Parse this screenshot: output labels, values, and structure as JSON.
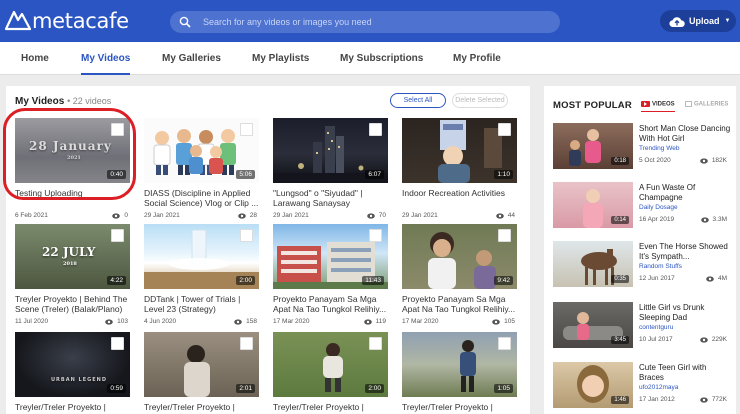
{
  "header": {
    "logo_text": "metacafe",
    "search_placeholder": "Search for any videos or images you need",
    "upload_label": "Upload"
  },
  "nav": {
    "items": [
      "Home",
      "My Videos",
      "My Galleries",
      "My Playlists",
      "My Subscriptions",
      "My Profile"
    ],
    "active": "My Videos"
  },
  "main": {
    "title": "My Videos",
    "count": "• 22 videos",
    "select_all": "Select All",
    "delete_selected": "Delete Selected",
    "videos": [
      {
        "title": "Testing Uploading",
        "date": "6 Feb 2021",
        "views": "0",
        "duration": "0:40",
        "thumb_text": "28 January",
        "thumb_year": "2021"
      },
      {
        "title": "DIASS (Discipline in Applied Social Science) Vlog or Clip ...",
        "date": "29 Jan 2021",
        "views": "28",
        "duration": "5:06"
      },
      {
        "title": "\"Lungsod\" o \"Siyudad\" | Larawang Sanaysay",
        "date": "29 Jan 2021",
        "views": "70",
        "duration": "6:07"
      },
      {
        "title": "Indoor Recreation Activities",
        "date": "29 Jan 2021",
        "views": "44",
        "duration": "1:10"
      },
      {
        "title": "Treyler Proyekto | Behind The Scene (Treler) (Balak/Plano) ...",
        "date": "11 Jul 2020",
        "views": "103",
        "duration": "4:22",
        "thumb_text": "22 JULY",
        "thumb_year": "2018"
      },
      {
        "title": "DDTank | Tower of Trials | Level 23 (Strategy)",
        "date": "4 Jun 2020",
        "views": "158",
        "duration": "2:00"
      },
      {
        "title": "Proyekto Panayam Sa Mga Apat Na Tao Tungkol Relihiy...",
        "date": "17 Mar 2020",
        "views": "119",
        "duration": "11:43"
      },
      {
        "title": "Proyekto Panayam Sa Mga Apat Na Tao Tungkol Relihiy...",
        "date": "17 Mar 2020",
        "views": "105",
        "duration": "9:42"
      },
      {
        "title": "Treyler/Treler Proyekto | Hango Buod (Project N...",
        "date": "",
        "views": "",
        "duration": "0:59",
        "thumb_text": "URBAN LEGEND"
      },
      {
        "title": "Treyler/Treler Proyekto | Hango Buod (Project N...",
        "date": "",
        "views": "",
        "duration": "2:01"
      },
      {
        "title": "Treyler/Treler Proyekto | Hango Buod (Project N...",
        "date": "",
        "views": "",
        "duration": "2:00"
      },
      {
        "title": "Treyler/Treler Proyekto | Hango Buod (Project N...",
        "date": "",
        "views": "",
        "duration": "1:05"
      }
    ]
  },
  "sidebar": {
    "title": "MOST POPULAR",
    "tab_videos": "VIDEOS",
    "tab_galleries": "GALLERIES",
    "items": [
      {
        "title": "Short Man Close Dancing With Hot Girl",
        "channel": "Trending Web",
        "date": "5 Oct 2020",
        "views": "182K",
        "duration": "0:18"
      },
      {
        "title": "A Fun Waste Of Champagne",
        "channel": "Daily Dosage",
        "date": "16 Apr 2019",
        "views": "3.3M",
        "duration": "0:14"
      },
      {
        "title": "Even The Horse Showed It's Sympath...",
        "channel": "Random Stuffs",
        "date": "12 Jun 2017",
        "views": "4M",
        "duration": "0:35"
      },
      {
        "title": "Little Girl vs Drunk Sleeping Dad",
        "channel": "contentguru",
        "date": "10 Jul 2017",
        "views": "229K",
        "duration": "3:45"
      },
      {
        "title": "Cute Teen Girl with Braces",
        "channel": "ufo2012maya",
        "date": "17 Jan 2012",
        "views": "772K",
        "duration": "1:46"
      }
    ]
  },
  "colors": {
    "header": "#2a55c2",
    "accent": "#2a55c2",
    "highlight_circle": "#dc1e25"
  }
}
